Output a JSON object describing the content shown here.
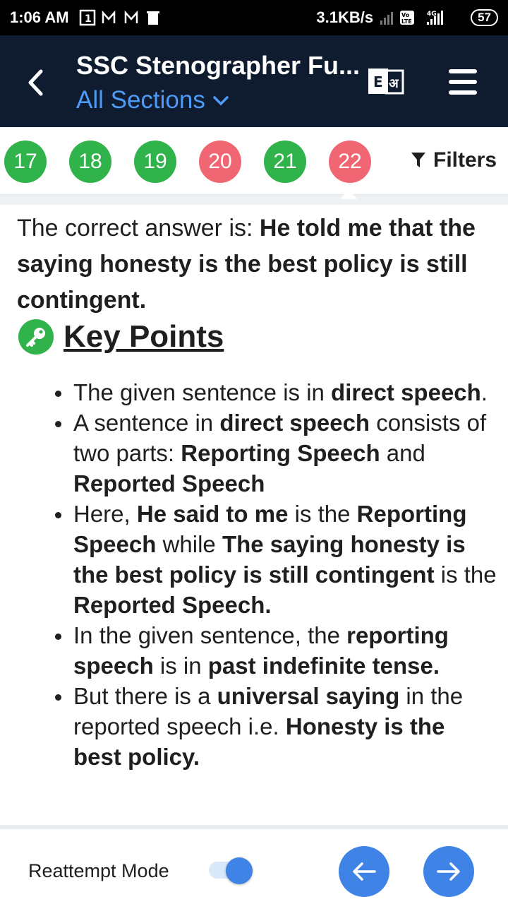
{
  "status_bar": {
    "time": "1:06 AM",
    "net_speed": "3.1KB/s",
    "volte": "Vo LTE",
    "network": "4G",
    "battery": "57"
  },
  "header": {
    "title": "SSC Stenographer Fu...",
    "section_select": "All Sections",
    "lang_toggle_e": "E",
    "lang_toggle_hi": "अ"
  },
  "question_numbers": [
    {
      "number": "17",
      "status": "correct"
    },
    {
      "number": "18",
      "status": "correct"
    },
    {
      "number": "19",
      "status": "correct"
    },
    {
      "number": "20",
      "status": "incorrect"
    },
    {
      "number": "21",
      "status": "correct"
    },
    {
      "number": "22",
      "status": "incorrect"
    }
  ],
  "filters_label": "Filters",
  "solution": {
    "answer_prefix": "The correct answer is: ",
    "answer_bold": "He told me that the saying honesty is the best policy is still contingent.",
    "key_points_title": "Key Points",
    "points": [
      [
        {
          "text": "The given sentence is in ",
          "bold": false
        },
        {
          "text": "direct speech",
          "bold": true
        },
        {
          "text": ".",
          "bold": false
        }
      ],
      [
        {
          "text": "A sentence in ",
          "bold": false
        },
        {
          "text": "direct speech",
          "bold": true
        },
        {
          "text": " consists of two parts: ",
          "bold": false
        },
        {
          "text": "Reporting Speech",
          "bold": true
        },
        {
          "text": " and ",
          "bold": false
        },
        {
          "text": "Reported Speech",
          "bold": true
        }
      ],
      [
        {
          "text": "Here, ",
          "bold": false
        },
        {
          "text": "He said to me",
          "bold": true
        },
        {
          "text": " is the ",
          "bold": false
        },
        {
          "text": "Reporting Speech",
          "bold": true
        },
        {
          "text": " while ",
          "bold": false
        },
        {
          "text": "The saying honesty is the best policy is still contingent",
          "bold": true
        },
        {
          "text": " is the ",
          "bold": false
        },
        {
          "text": "Reported Speech.",
          "bold": true
        }
      ],
      [
        {
          "text": "In the given sentence, the ",
          "bold": false
        },
        {
          "text": "reporting speech",
          "bold": true
        },
        {
          "text": " is in ",
          "bold": false
        },
        {
          "text": "past indefinite tense.",
          "bold": true
        }
      ],
      [
        {
          "text": "But there is a ",
          "bold": false
        },
        {
          "text": "universal saying",
          "bold": true
        },
        {
          "text": " in the reported speech i.e. ",
          "bold": false
        },
        {
          "text": "Honesty is the best policy.",
          "bold": true
        }
      ]
    ]
  },
  "bottom_bar": {
    "reattempt_label": "Reattempt Mode",
    "reattempt_on": true
  },
  "colors": {
    "header_bg": "#0f1b2f",
    "accent_blue": "#3f83e6",
    "link_blue": "#4e9bf7",
    "correct_green": "#2fb34a",
    "incorrect_red": "#f06672"
  }
}
